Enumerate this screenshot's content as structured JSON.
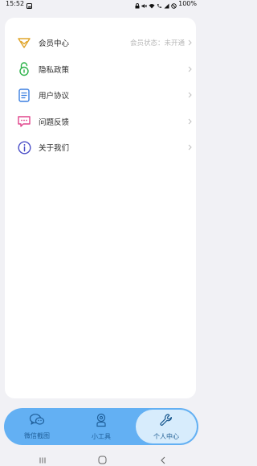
{
  "status_bar": {
    "time": "15:52",
    "battery": "100%",
    "icons": [
      "image-icon",
      "lock-icon",
      "mute-icon",
      "wifi-icon",
      "call-icon",
      "signal-icon",
      "no-disturb-icon"
    ]
  },
  "menu": {
    "items": [
      {
        "label": "会员中心",
        "status": "会员状态：未开通",
        "icon": "vip-diamond-icon",
        "color": "#e0a52b"
      },
      {
        "label": "隐私政策",
        "icon": "privacy-lock-icon",
        "color": "#2db34a"
      },
      {
        "label": "用户协议",
        "icon": "document-icon",
        "color": "#3b7fe0"
      },
      {
        "label": "问题反馈",
        "icon": "feedback-chat-icon",
        "color": "#e0458c"
      },
      {
        "label": "关于我们",
        "icon": "info-icon",
        "color": "#4b4fc8"
      }
    ],
    "chevron": "chevron-right-icon"
  },
  "tabs": [
    {
      "label": "微信截图",
      "icon": "wechat-icon",
      "active": false
    },
    {
      "label": "小工具",
      "icon": "tool-person-icon",
      "active": false
    },
    {
      "label": "个人中心",
      "icon": "wrench-icon",
      "active": true
    }
  ],
  "colors": {
    "tabbar_bg": "#63b0f3",
    "tab_active_bg": "#d7ecfc",
    "page_bg": "#f1f1f5",
    "card_bg": "#ffffff"
  }
}
